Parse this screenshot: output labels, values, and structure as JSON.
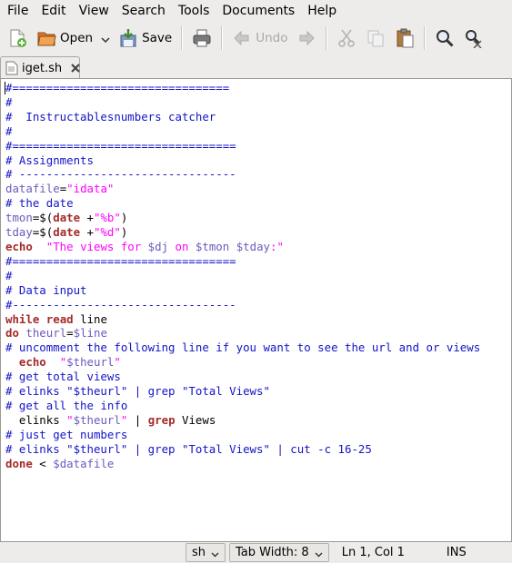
{
  "menu": [
    "File",
    "Edit",
    "View",
    "Search",
    "Tools",
    "Documents",
    "Help"
  ],
  "toolbar": {
    "open": "Open",
    "save": "Save",
    "undo": "Undo"
  },
  "tab": {
    "title": "iget.sh"
  },
  "code": [
    [
      [
        "c",
        "#================================"
      ]
    ],
    [
      [
        "c",
        "#"
      ]
    ],
    [
      [
        "c",
        "#  Instructablesnumbers catcher"
      ]
    ],
    [
      [
        "c",
        "#"
      ]
    ],
    [
      [
        "c",
        "#================================="
      ]
    ],
    [
      [
        "c",
        "# Assignments"
      ]
    ],
    [
      [
        "c",
        "# --------------------------------"
      ]
    ],
    [
      [
        "v",
        "datafile"
      ],
      [
        "o",
        "="
      ],
      [
        "s",
        "\"idata\""
      ]
    ],
    [
      [
        "c",
        "# the date"
      ]
    ],
    [
      [
        "v",
        "tmon"
      ],
      [
        "o",
        "=$("
      ],
      [
        "k",
        "date"
      ],
      [
        "o",
        " +"
      ],
      [
        "s",
        "\"%b\""
      ],
      [
        "o",
        ")"
      ]
    ],
    [
      [
        "v",
        "tday"
      ],
      [
        "o",
        "=$("
      ],
      [
        "k",
        "date"
      ],
      [
        "o",
        " +"
      ],
      [
        "s",
        "\"%d\""
      ],
      [
        "o",
        ")"
      ]
    ],
    [
      [
        "k",
        "echo"
      ],
      [
        "o",
        "  "
      ],
      [
        "s",
        "\"The views for "
      ],
      [
        "v",
        "$dj"
      ],
      [
        "s",
        " on "
      ],
      [
        "v",
        "$tmon"
      ],
      [
        "s",
        " "
      ],
      [
        "v",
        "$tday"
      ],
      [
        "s",
        ":\""
      ]
    ],
    [
      [
        "c",
        "#================================="
      ]
    ],
    [
      [
        "c",
        "#"
      ]
    ],
    [
      [
        "c",
        "# Data input"
      ]
    ],
    [
      [
        "c",
        "#---------------------------------"
      ]
    ],
    [
      [
        "k",
        "while"
      ],
      [
        "o",
        " "
      ],
      [
        "k",
        "read"
      ],
      [
        "o",
        " line"
      ]
    ],
    [
      [
        "k",
        "do"
      ],
      [
        "o",
        " "
      ],
      [
        "v",
        "theurl"
      ],
      [
        "o",
        "="
      ],
      [
        "v",
        "$line"
      ]
    ],
    [
      [
        "c",
        "# uncomment the following line if you want to see the url and or views"
      ]
    ],
    [
      [
        "o",
        "  "
      ],
      [
        "k",
        "echo"
      ],
      [
        "o",
        "  "
      ],
      [
        "s",
        "\""
      ],
      [
        "v",
        "$theurl"
      ],
      [
        "s",
        "\""
      ]
    ],
    [
      [
        "c",
        "# get total views"
      ]
    ],
    [
      [
        "c",
        "# elinks \"$theurl\" | grep \"Total Views\""
      ]
    ],
    [
      [
        "c",
        "# get all the info"
      ]
    ],
    [
      [
        "o",
        "  elinks "
      ],
      [
        "s",
        "\""
      ],
      [
        "v",
        "$theurl"
      ],
      [
        "s",
        "\""
      ],
      [
        "o",
        " | "
      ],
      [
        "k",
        "grep"
      ],
      [
        "o",
        " Views"
      ]
    ],
    [
      [
        "c",
        "# just get numbers"
      ]
    ],
    [
      [
        "c",
        "# elinks \"$theurl\" | grep \"Total Views\" | cut -c 16-25"
      ]
    ],
    [
      [
        "k",
        "done"
      ],
      [
        "o",
        " < "
      ],
      [
        "v",
        "$datafile"
      ]
    ]
  ],
  "status": {
    "language": "sh",
    "tab_width": "Tab Width:  8",
    "position": "Ln 1, Col 1",
    "mode": "INS"
  }
}
